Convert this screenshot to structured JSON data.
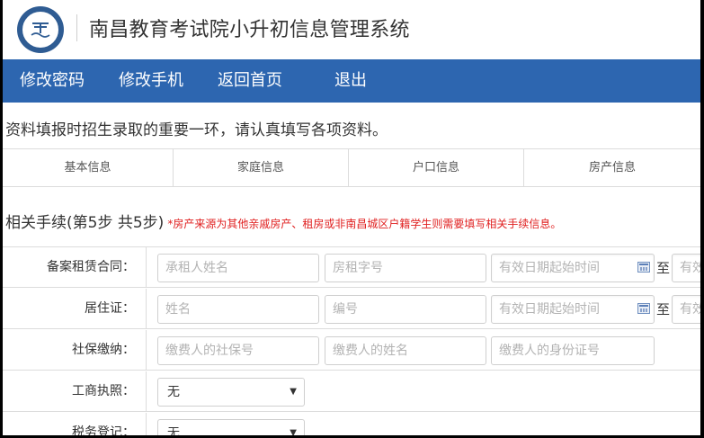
{
  "header": {
    "title": "南昌教育考试院小升初信息管理系统"
  },
  "nav": {
    "items": [
      "修改密码",
      "修改手机",
      "返回首页",
      "退出"
    ]
  },
  "notice": "资料填报时招生录取的重要一环，请认真填写各项资料。",
  "tabs": [
    "基本信息",
    "家庭信息",
    "户口信息",
    "房产信息"
  ],
  "step": {
    "title": "相关手续(第5步 共5步)",
    "note": "*房产来源为其他亲戚房产、租房或非南昌城区户籍学生则需要填写相关手续信息。"
  },
  "form": {
    "rows": [
      {
        "label": "备案租赁合同：",
        "f1": "承租人姓名",
        "f2": "房租字号",
        "f3": "有效日期起始时间",
        "to": "至",
        "f4": "有效"
      },
      {
        "label": "居住证：",
        "f1": "姓名",
        "f2": "编号",
        "f3": "有效日期起始时间",
        "to": "至",
        "f4": "有效"
      },
      {
        "label": "社保缴纳：",
        "f1": "缴费人的社保号",
        "f2": "缴费人的姓名",
        "f3": "缴费人的身份证号"
      },
      {
        "label": "工商执照：",
        "select": "无"
      },
      {
        "label": "税务登记：",
        "select": "无"
      }
    ]
  },
  "colors": {
    "nav_bg": "#2d66b0",
    "note_red": "#e02020",
    "logo_blue": "#2f5c93"
  }
}
